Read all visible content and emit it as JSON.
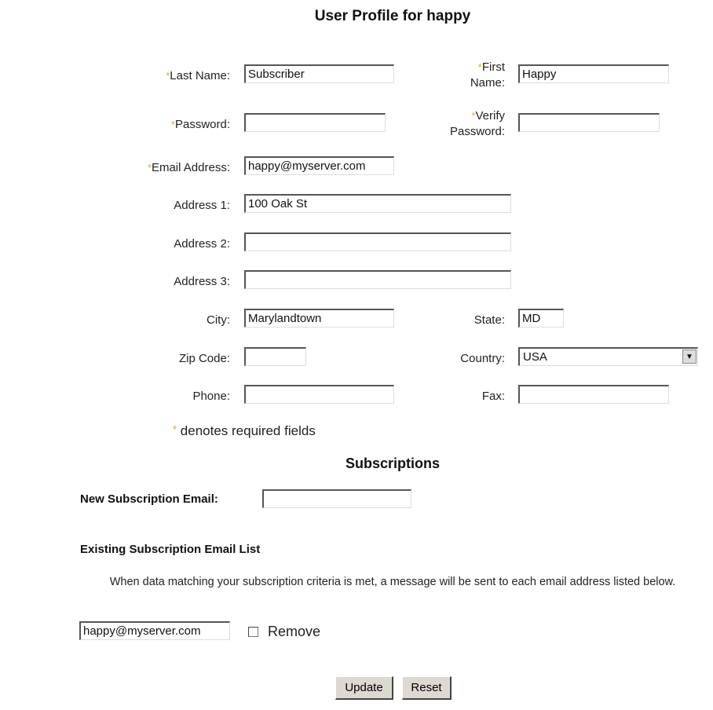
{
  "page_title": "User Profile for happy",
  "required_marker": "*",
  "fields": {
    "last_name": {
      "label": "Last Name:",
      "value": "Subscriber",
      "required": true
    },
    "first_name": {
      "label_line1": "First",
      "label_line2": "Name:",
      "value": "Happy",
      "required": true
    },
    "password": {
      "label": "Password:",
      "value": "",
      "required": true
    },
    "verify_password": {
      "label_line1": "Verify",
      "label_line2": "Password:",
      "value": "",
      "required": true
    },
    "email": {
      "label": "Email Address:",
      "value": "happy@myserver.com",
      "required": true
    },
    "address1": {
      "label": "Address 1:",
      "value": "100 Oak St"
    },
    "address2": {
      "label": "Address 2:",
      "value": ""
    },
    "address3": {
      "label": "Address 3:",
      "value": ""
    },
    "city": {
      "label": "City:",
      "value": "Marylandtown"
    },
    "state": {
      "label": "State:",
      "value": "MD"
    },
    "zip": {
      "label": "Zip Code:",
      "value": ""
    },
    "country": {
      "label": "Country:",
      "selected": "USA"
    },
    "phone": {
      "label": "Phone:",
      "value": ""
    },
    "fax": {
      "label": "Fax:",
      "value": ""
    }
  },
  "required_note": "denotes required fields",
  "subscriptions": {
    "heading": "Subscriptions",
    "new_label": "New Subscription Email:",
    "new_value": "",
    "existing_heading": "Existing Subscription Email List",
    "description": "When data matching your subscription criteria is met, a message will be sent to each email address listed below.",
    "list": [
      {
        "email": "happy@myserver.com",
        "remove_label": "Remove",
        "remove_checked": false
      }
    ]
  },
  "buttons": {
    "update": "Update",
    "reset": "Reset"
  },
  "icons": {
    "dropdown": "chevron-down-icon",
    "checkbox": "checkbox-icon"
  }
}
